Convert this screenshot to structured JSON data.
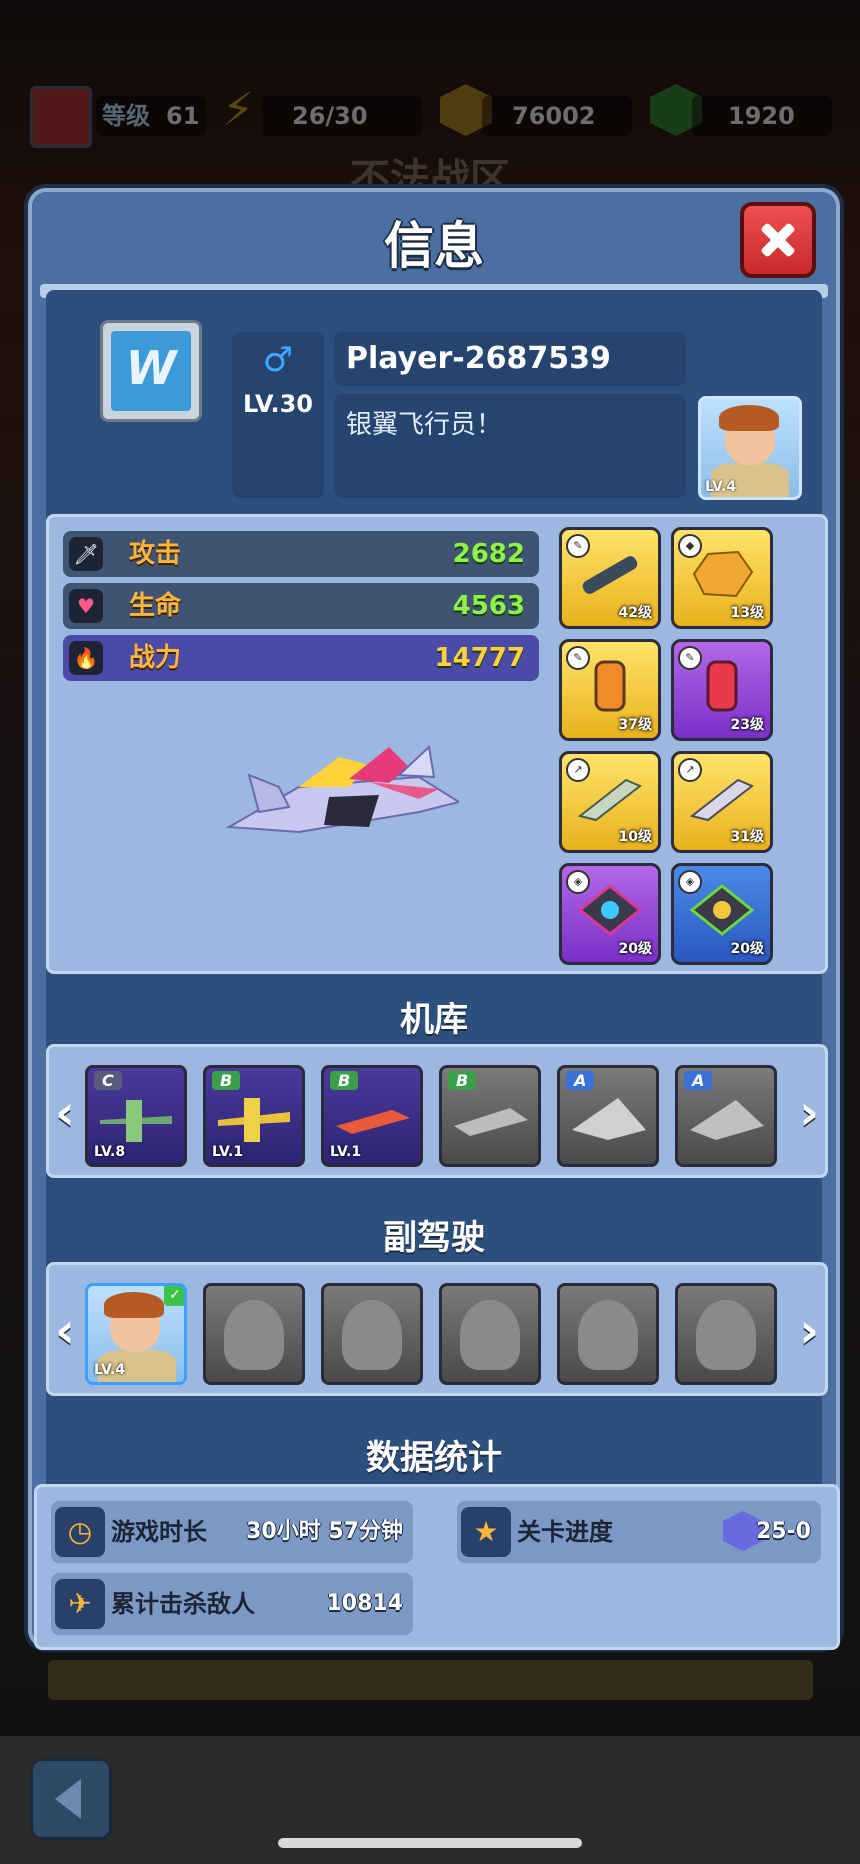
{
  "topbar": {
    "level_label": "等级",
    "level_value": "61",
    "energy": "26/30",
    "gold": "76002",
    "gems": "1920"
  },
  "background_title": "不法战区",
  "dialog": {
    "title": "信息"
  },
  "profile": {
    "gender_symbol": "♂",
    "level": "LV.30",
    "name": "Player-2687539",
    "signature": "银翼飞行员！",
    "copilot_level": "LV.4"
  },
  "stats": [
    {
      "label": "攻击",
      "value": "2682",
      "icon": "sword-icon"
    },
    {
      "label": "生命",
      "value": "4563",
      "icon": "heart-icon"
    },
    {
      "label": "战力",
      "value": "14777",
      "icon": "fire-icon"
    }
  ],
  "equipment": [
    {
      "level": "42级",
      "rarity": "gold",
      "icon": "cannon-icon"
    },
    {
      "level": "13级",
      "rarity": "gold",
      "icon": "armor-icon"
    },
    {
      "level": "37级",
      "rarity": "gold",
      "icon": "canister-icon"
    },
    {
      "level": "23级",
      "rarity": "purple",
      "icon": "canister-icon"
    },
    {
      "level": "10级",
      "rarity": "gold",
      "icon": "drone-icon"
    },
    {
      "level": "31级",
      "rarity": "gold",
      "icon": "drone-icon"
    },
    {
      "level": "20级",
      "rarity": "purple",
      "icon": "chip-icon"
    },
    {
      "level": "20级",
      "rarity": "blue",
      "icon": "chip-icon"
    }
  ],
  "hangar": {
    "title": "机库",
    "planes": [
      {
        "rank": "C",
        "level": "LV.8",
        "owned": true,
        "color": "#6ea86a"
      },
      {
        "rank": "B",
        "level": "LV.1",
        "owned": true,
        "color": "#e8c23a"
      },
      {
        "rank": "B",
        "level": "LV.1",
        "owned": true,
        "color": "#e85a3a"
      },
      {
        "rank": "B",
        "level": "",
        "owned": false,
        "color": "#9a9a9a"
      },
      {
        "rank": "A",
        "level": "",
        "owned": false,
        "color": "#b0b0b0"
      },
      {
        "rank": "A",
        "level": "",
        "owned": false,
        "color": "#a0a0a0"
      }
    ]
  },
  "copilots": {
    "title": "副驾驶",
    "list": [
      {
        "level": "LV.4",
        "selected": true
      },
      {
        "level": "",
        "selected": false
      },
      {
        "level": "",
        "selected": false
      },
      {
        "level": "",
        "selected": false
      },
      {
        "level": "",
        "selected": false
      },
      {
        "level": "",
        "selected": false
      }
    ]
  },
  "data_stats": {
    "title": "数据统计",
    "playtime_label": "游戏时长",
    "playtime_value": "30小时 57分钟",
    "progress_label": "关卡进度",
    "progress_value": "25-0",
    "kills_label": "累计击杀敌人",
    "kills_value": "10814"
  }
}
